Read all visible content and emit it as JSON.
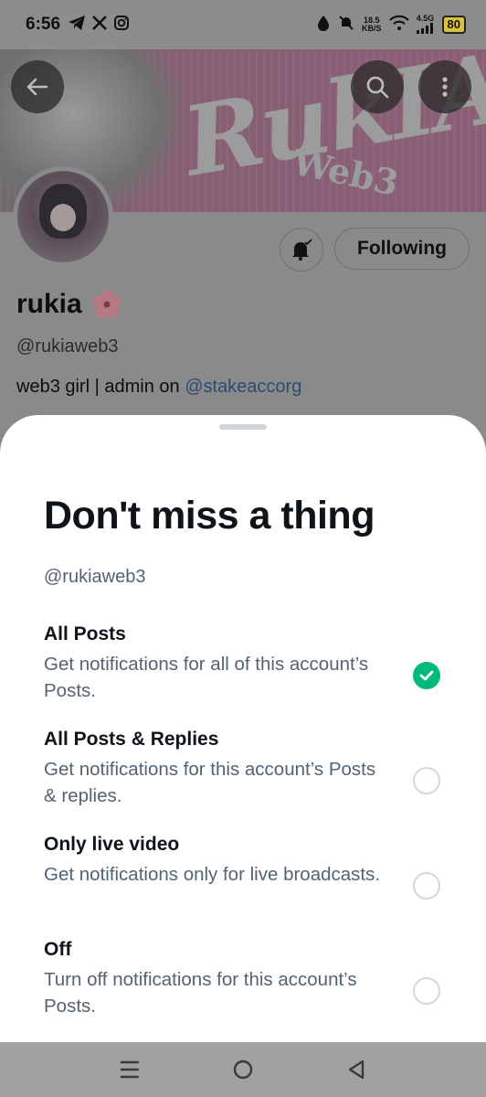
{
  "status_bar": {
    "time": "6:56",
    "left_icons": [
      "telegram-icon",
      "x-icon",
      "instagram-icon"
    ],
    "data_speed_value": "18.5",
    "data_speed_unit": "KB/S",
    "network": "4.5G",
    "battery": "80"
  },
  "banner": {
    "word": "RukIA",
    "sub": "Web3"
  },
  "profile": {
    "follow_label": "Following",
    "name": "rukia",
    "handle": "@rukiaweb3",
    "bio_prefix": "web3 girl | admin on ",
    "bio_mention": "@stakeaccorg"
  },
  "sheet": {
    "title": "Don't miss a thing",
    "handle": "@rukiaweb3",
    "options": [
      {
        "title": "All Posts",
        "desc": "Get notifications for all of this account’s Posts.",
        "selected": true
      },
      {
        "title": "All Posts & Replies",
        "desc": "Get notifications for this account’s Posts & replies.",
        "selected": false
      },
      {
        "title": "Only live video",
        "desc": "Get notifications only for live broadcasts.",
        "selected": false
      },
      {
        "title": "Off",
        "desc": "Turn off notifications for this account’s Posts.",
        "selected": false
      }
    ]
  },
  "colors": {
    "accent_green": "#00ba7c",
    "secondary_text": "#536471",
    "primary_text": "#0f1419"
  }
}
